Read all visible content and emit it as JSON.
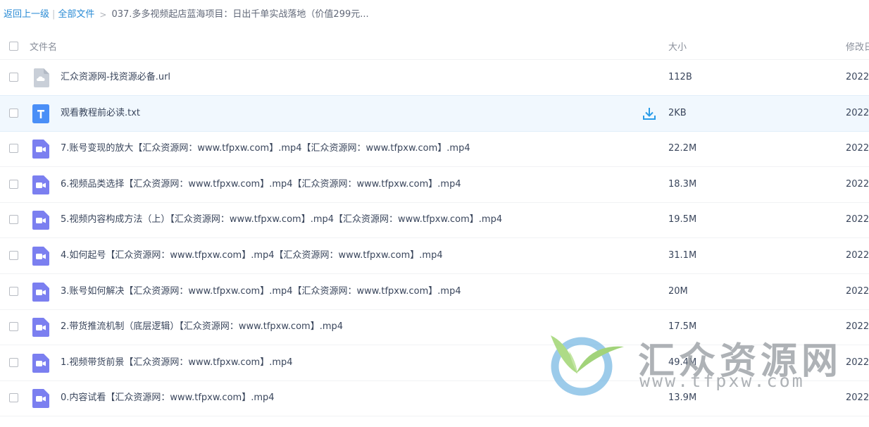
{
  "breadcrumb": {
    "back_label": "返回上一级",
    "separator": "|",
    "all_files_label": "全部文件",
    "arrow": ">",
    "current_folder": "037.多多视频起店蓝海项目：日出千单实战落地（价值299元..."
  },
  "table": {
    "header": {
      "name_label": "文件名",
      "size_label": "大小",
      "date_label": "修改日"
    },
    "rows": [
      {
        "icon": "url-file-icon",
        "name": "汇众资源网-找资源必备.url",
        "size": "112B",
        "date": "2022-"
      },
      {
        "icon": "txt-file-icon",
        "name": "观看教程前必读.txt",
        "size": "2KB",
        "date": "2022-",
        "hovered": true
      },
      {
        "icon": "video-file-icon",
        "name": "7.账号变现的放大【汇众资源网：www.tfpxw.com】.mp4【汇众资源网：www.tfpxw.com】.mp4",
        "size": "22.2M",
        "date": "2022-"
      },
      {
        "icon": "video-file-icon",
        "name": "6.视频品类选择【汇众资源网：www.tfpxw.com】.mp4【汇众资源网：www.tfpxw.com】.mp4",
        "size": "18.3M",
        "date": "2022-"
      },
      {
        "icon": "video-file-icon",
        "name": "5.视频内容构成方法（上）【汇众资源网：www.tfpxw.com】.mp4【汇众资源网：www.tfpxw.com】.mp4",
        "size": "19.5M",
        "date": "2022-"
      },
      {
        "icon": "video-file-icon",
        "name": "4.如何起号【汇众资源网：www.tfpxw.com】.mp4【汇众资源网：www.tfpxw.com】.mp4",
        "size": "31.1M",
        "date": "2022-"
      },
      {
        "icon": "video-file-icon",
        "name": "3.账号如何解决【汇众资源网：www.tfpxw.com】.mp4【汇众资源网：www.tfpxw.com】.mp4",
        "size": "20M",
        "date": "2022-"
      },
      {
        "icon": "video-file-icon",
        "name": "2.带货推流机制（底层逻辑）【汇众资源网：www.tfpxw.com】.mp4",
        "size": "17.5M",
        "date": "2022-"
      },
      {
        "icon": "video-file-icon",
        "name": "1.视频带货前景【汇众资源网：www.tfpxw.com】.mp4",
        "size": "49.4M",
        "date": "2022-"
      },
      {
        "icon": "video-file-icon",
        "name": "0.内容试看【汇众资源网：www.tfpxw.com】.mp4",
        "size": "13.9M",
        "date": "2022-"
      }
    ]
  },
  "watermark": {
    "title": "汇众资源网",
    "url": "www.tfpxw.com"
  },
  "colors": {
    "link": "#2a8bd5",
    "video_icon": "#7b7ff0",
    "txt_icon": "#4a8ff7",
    "url_icon": "#c9cfd8",
    "download_icon": "#2a9ce8",
    "hover_row": "#f1f8fe"
  }
}
